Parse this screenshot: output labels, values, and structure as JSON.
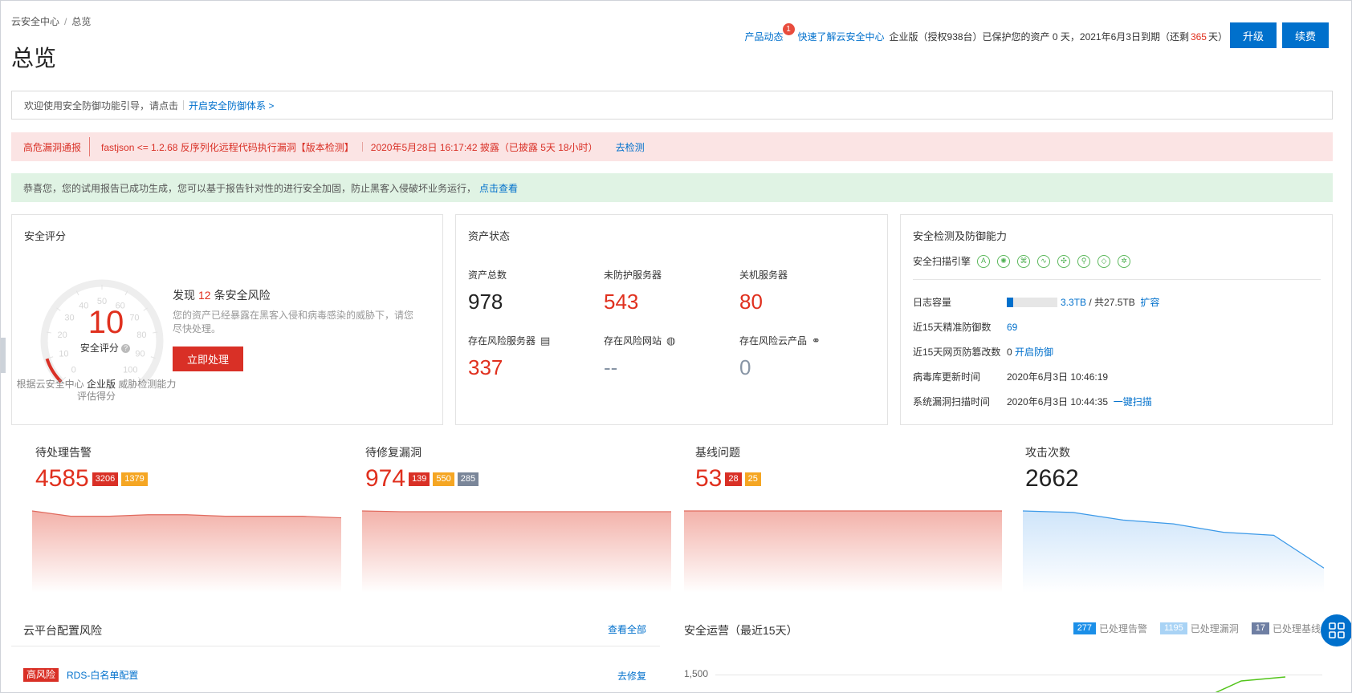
{
  "breadcrumb": {
    "root": "云安全中心",
    "separator": "/",
    "current": "总览"
  },
  "page_title": "总览",
  "header": {
    "news_label": "产品动态",
    "news_badge": "1",
    "quick_label": "快速了解云安全中心",
    "license_text": "企业版（授权938台）已保护您的资产 0 天，2021年6月3日到期（还剩",
    "days_left": "365",
    "days_suffix": "天）",
    "upgrade_label": "升级",
    "renew_label": "续费"
  },
  "guide_bar": {
    "text": "欢迎使用安全防御功能引导，请点击",
    "link": "开启安全防御体系 >"
  },
  "vuln_bar": {
    "tag": "高危漏洞通报",
    "title": "fastjson <= 1.2.68 反序列化远程代码执行漏洞【版本检测】",
    "disclosed": "2020年5月28日 16:17:42 披露（已披露 5天 18小时）",
    "action": "去检测"
  },
  "ok_bar": {
    "text": "恭喜您，您的试用报告已成功生成，您可以基于报告针对性的进行安全加固，防止黑客入侵破坏业务运行，",
    "link": "点击查看"
  },
  "score_card": {
    "title": "安全评分",
    "score": "10",
    "score_value": 10,
    "score_label": "安全评分",
    "help_icon": "question-icon",
    "gauge_ticks": [
      "0",
      "10",
      "20",
      "30",
      "40",
      "50",
      "60",
      "70",
      "80",
      "90",
      "100"
    ],
    "foot_prefix": "根据云安全中心",
    "foot_edition": "企业版",
    "foot_suffix": "威胁检测能力",
    "foot_line2": "评估得分",
    "risk_prefix": "发现",
    "risk_count": "12",
    "risk_suffix": "条安全风险",
    "risk_desc": "您的资产已经暴露在黑客入侵和病毒感染的威胁下，请您尽快处理。",
    "action": "立即处理"
  },
  "asset_card": {
    "title": "资产状态",
    "items": [
      {
        "label": "资产总数",
        "value": "978",
        "icon": ""
      },
      {
        "label": "未防护服务器",
        "value": "543",
        "icon": ""
      },
      {
        "label": "关机服务器",
        "value": "80",
        "icon": ""
      },
      {
        "label": "存在风险服务器",
        "value": "337",
        "icon": "server-icon"
      },
      {
        "label": "存在风险网站",
        "value": "--",
        "icon": "globe-icon"
      },
      {
        "label": "存在风险云产品",
        "value": "0",
        "icon": "cloud-products-icon"
      }
    ]
  },
  "detect_card": {
    "title": "安全检测及防御能力",
    "engine_label": "安全扫描引擎",
    "engine_icons": [
      "shield-a-icon",
      "virus-icon",
      "bug-icon",
      "wave-icon",
      "network-icon",
      "search-icon",
      "cube-icon",
      "cluster-icon"
    ],
    "log_label": "日志容量",
    "log_used": "3.3TB",
    "log_total": "/ 共27.5TB",
    "log_fraction": 0.12,
    "log_action": "扩容",
    "defense_label": "近15天精准防御数",
    "defense_value": "69",
    "tamper_label": "近15天网页防篡改数",
    "tamper_value": "0",
    "tamper_action": "开启防御",
    "virus_label": "病毒库更新时间",
    "virus_value": "2020年6月3日 10:46:19",
    "scan_label": "系统漏洞扫描时间",
    "scan_value": "2020年6月3日 10:44:35",
    "scan_action": "一键扫描"
  },
  "stats": [
    {
      "label": "待处理告警",
      "value": "4585",
      "tags": [
        "3206",
        "1379"
      ],
      "trend": [
        100,
        93,
        93,
        95,
        95,
        93,
        93,
        93,
        91
      ]
    },
    {
      "label": "待修复漏洞",
      "value": "974",
      "tags": [
        "139",
        "550",
        "285"
      ],
      "trend": [
        100,
        99,
        99,
        99,
        99,
        99,
        99,
        99,
        99
      ]
    },
    {
      "label": "基线问题",
      "value": "53",
      "tags": [
        "28",
        "25"
      ],
      "trend": [
        100,
        100,
        100,
        100,
        100,
        100,
        100,
        100,
        100
      ]
    },
    {
      "label": "攻击次数",
      "value": "2662",
      "tags": [],
      "trend": [
        100,
        98,
        88,
        83,
        72,
        68,
        25
      ]
    }
  ],
  "config_risk": {
    "title": "云平台配置风险",
    "view_all": "查看全部",
    "rows": [
      {
        "level": "高风险",
        "name": "RDS-白名单配置",
        "action": "去修复"
      }
    ]
  },
  "ops": {
    "title": "安全运营（最近15天）",
    "legend": [
      {
        "num": "277",
        "label": "已处理告警",
        "color": "#1b8fe8"
      },
      {
        "num": "1195",
        "label": "已处理漏洞",
        "color": "#a9d3f5"
      },
      {
        "num": "17",
        "label": "已处理基线",
        "color": "#6f7fa3"
      }
    ],
    "y_tick": "1,500"
  },
  "colors": {
    "accent": "#0070cc",
    "danger": "#d93026",
    "warning": "#f5a623",
    "success": "#4caf50"
  }
}
